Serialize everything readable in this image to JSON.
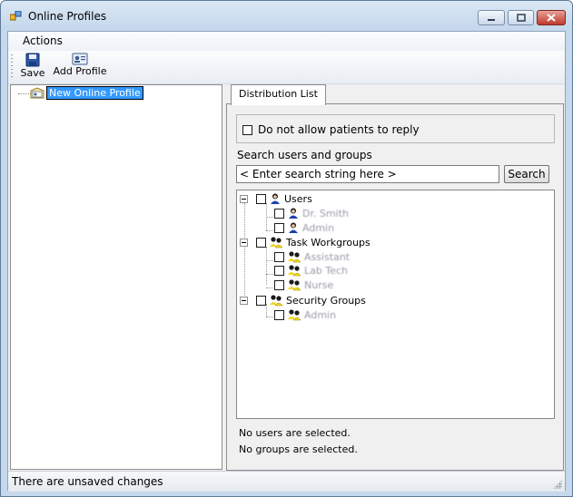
{
  "window": {
    "title": "Online Profiles"
  },
  "menu": {
    "actions": "Actions"
  },
  "toolbar": {
    "save_label": "Save",
    "add_profile_label": "Add Profile"
  },
  "profiles_tree": {
    "items": [
      {
        "label": "New Online Profile",
        "selected": true,
        "icon": "profile-card-icon"
      }
    ]
  },
  "tabs": [
    {
      "label": "Distribution List",
      "active": true
    }
  ],
  "distribution": {
    "reply_checkbox_label": "Do not allow patients to reply",
    "reply_checked": false,
    "search_caption": "Search users and groups",
    "search_value": "< Enter search string here >",
    "search_button": "Search",
    "tree": {
      "users": {
        "label": "Users",
        "icon": "user-icon",
        "children": [
          "Dr. Smith",
          "Admin"
        ]
      },
      "task_workgroups": {
        "label": "Task Workgroups",
        "icon": "group-icon",
        "children": [
          "Assistant",
          "Lab Tech",
          "Nurse"
        ]
      },
      "security_groups": {
        "label": "Security Groups",
        "icon": "group-icon",
        "children": [
          "Admin"
        ]
      }
    },
    "status_users": "No users are selected.",
    "status_groups": "No groups are selected."
  },
  "statusbar": {
    "text": "There are unsaved changes"
  },
  "colors": {
    "selection": "#3399ff",
    "titlebar": "#c5d8ec",
    "close_button": "#c0392b"
  }
}
